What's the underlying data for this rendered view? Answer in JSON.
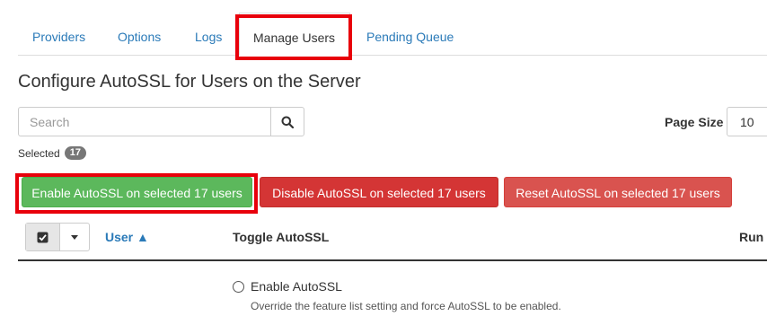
{
  "tabs": [
    {
      "label": "Providers"
    },
    {
      "label": "Options"
    },
    {
      "label": "Logs"
    },
    {
      "label": "Manage Users"
    },
    {
      "label": "Pending Queue"
    }
  ],
  "page_title": "Configure AutoSSL for Users on the Server",
  "search": {
    "placeholder": "Search",
    "value": "",
    "button_icon": "search-icon"
  },
  "page_size": {
    "label": "Page Size",
    "value": "10"
  },
  "selected": {
    "label": "Selected",
    "count": "17"
  },
  "actions": {
    "enable_label": "Enable AutoSSL on selected 17 users",
    "disable_label": "Disable AutoSSL on selected 17 users",
    "reset_label": "Reset AutoSSL on selected 17 users"
  },
  "table": {
    "columns": {
      "user": "User ▲",
      "toggle": "Toggle AutoSSL",
      "run": "Run"
    }
  },
  "row": {
    "option_label": "Enable AutoSSL",
    "option_description": "Override the feature list setting and force AutoSSL to be enabled."
  },
  "colors": {
    "link": "#2a7ab8",
    "enable_button": "#5cb85c",
    "disable_button": "#d43535",
    "reset_button": "#d9534f",
    "highlight": "#e8000b"
  }
}
